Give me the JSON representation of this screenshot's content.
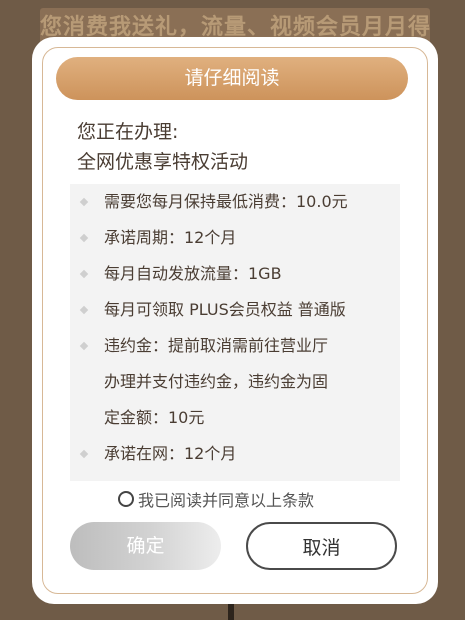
{
  "background": {
    "banner_text": "您消费我送礼，流量、视频会员月月得"
  },
  "dialog": {
    "title": "请仔细阅读",
    "intro_line1": "您正在办理:",
    "intro_line2": "全网优惠享特权活动",
    "terms": [
      "需要您每月保持最低消费：10.0元",
      "承诺周期：12个月",
      "每月自动发放流量：1GB",
      "每月可领取 PLUS会员权益 普通版",
      "违约金：提前取消需前往营业厅\n办理并支付违约金，违约金为固\n定金额：10元",
      "承诺在网：12个月"
    ],
    "agree_label": "我已阅读并同意以上条款",
    "agree_checked": false,
    "confirm_label": "确定",
    "cancel_label": "取消"
  },
  "colors": {
    "accent": "#cf955c",
    "border": "#d7b896",
    "text": "#4a3d33",
    "list_bg": "#f3f3f3"
  }
}
